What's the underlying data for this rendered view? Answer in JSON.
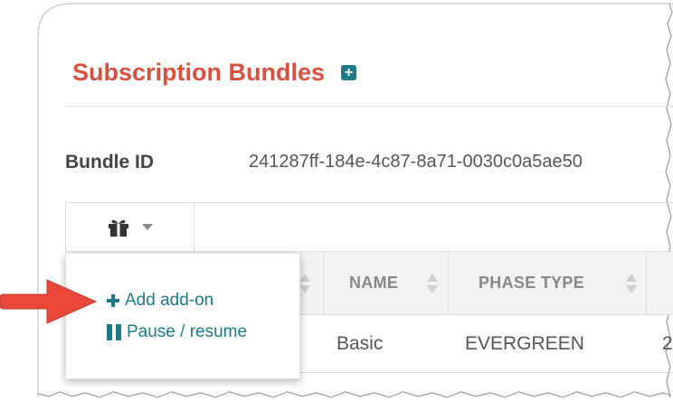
{
  "header": {
    "title": "Subscription Bundles",
    "add_icon": "plus-square-icon"
  },
  "bundle": {
    "id_label": "Bundle ID",
    "id_value": "241287ff-184e-4c87-8a71-0030c0a5ae50"
  },
  "table": {
    "actions_icon": "gift-icon",
    "actions_caret": "caret-down-icon",
    "columns": [
      {
        "label": "",
        "sortable": true
      },
      {
        "label": "NAME",
        "sortable": true
      },
      {
        "label": "PHASE TYPE",
        "sortable": true
      }
    ],
    "rows": [
      {
        "name": "Basic",
        "phase_type": "EVERGREEN",
        "next": "2"
      }
    ]
  },
  "dropdown": {
    "items": [
      {
        "label": "Add add-on",
        "icon": "plus-icon"
      },
      {
        "label": "Pause / resume",
        "icon": "pause-icon"
      }
    ]
  },
  "colors": {
    "title": "#d9503f",
    "accent": "#1c7b84",
    "arrow": "#e8473a",
    "header_bg": "#f2f2f2",
    "header_text": "#888888"
  }
}
